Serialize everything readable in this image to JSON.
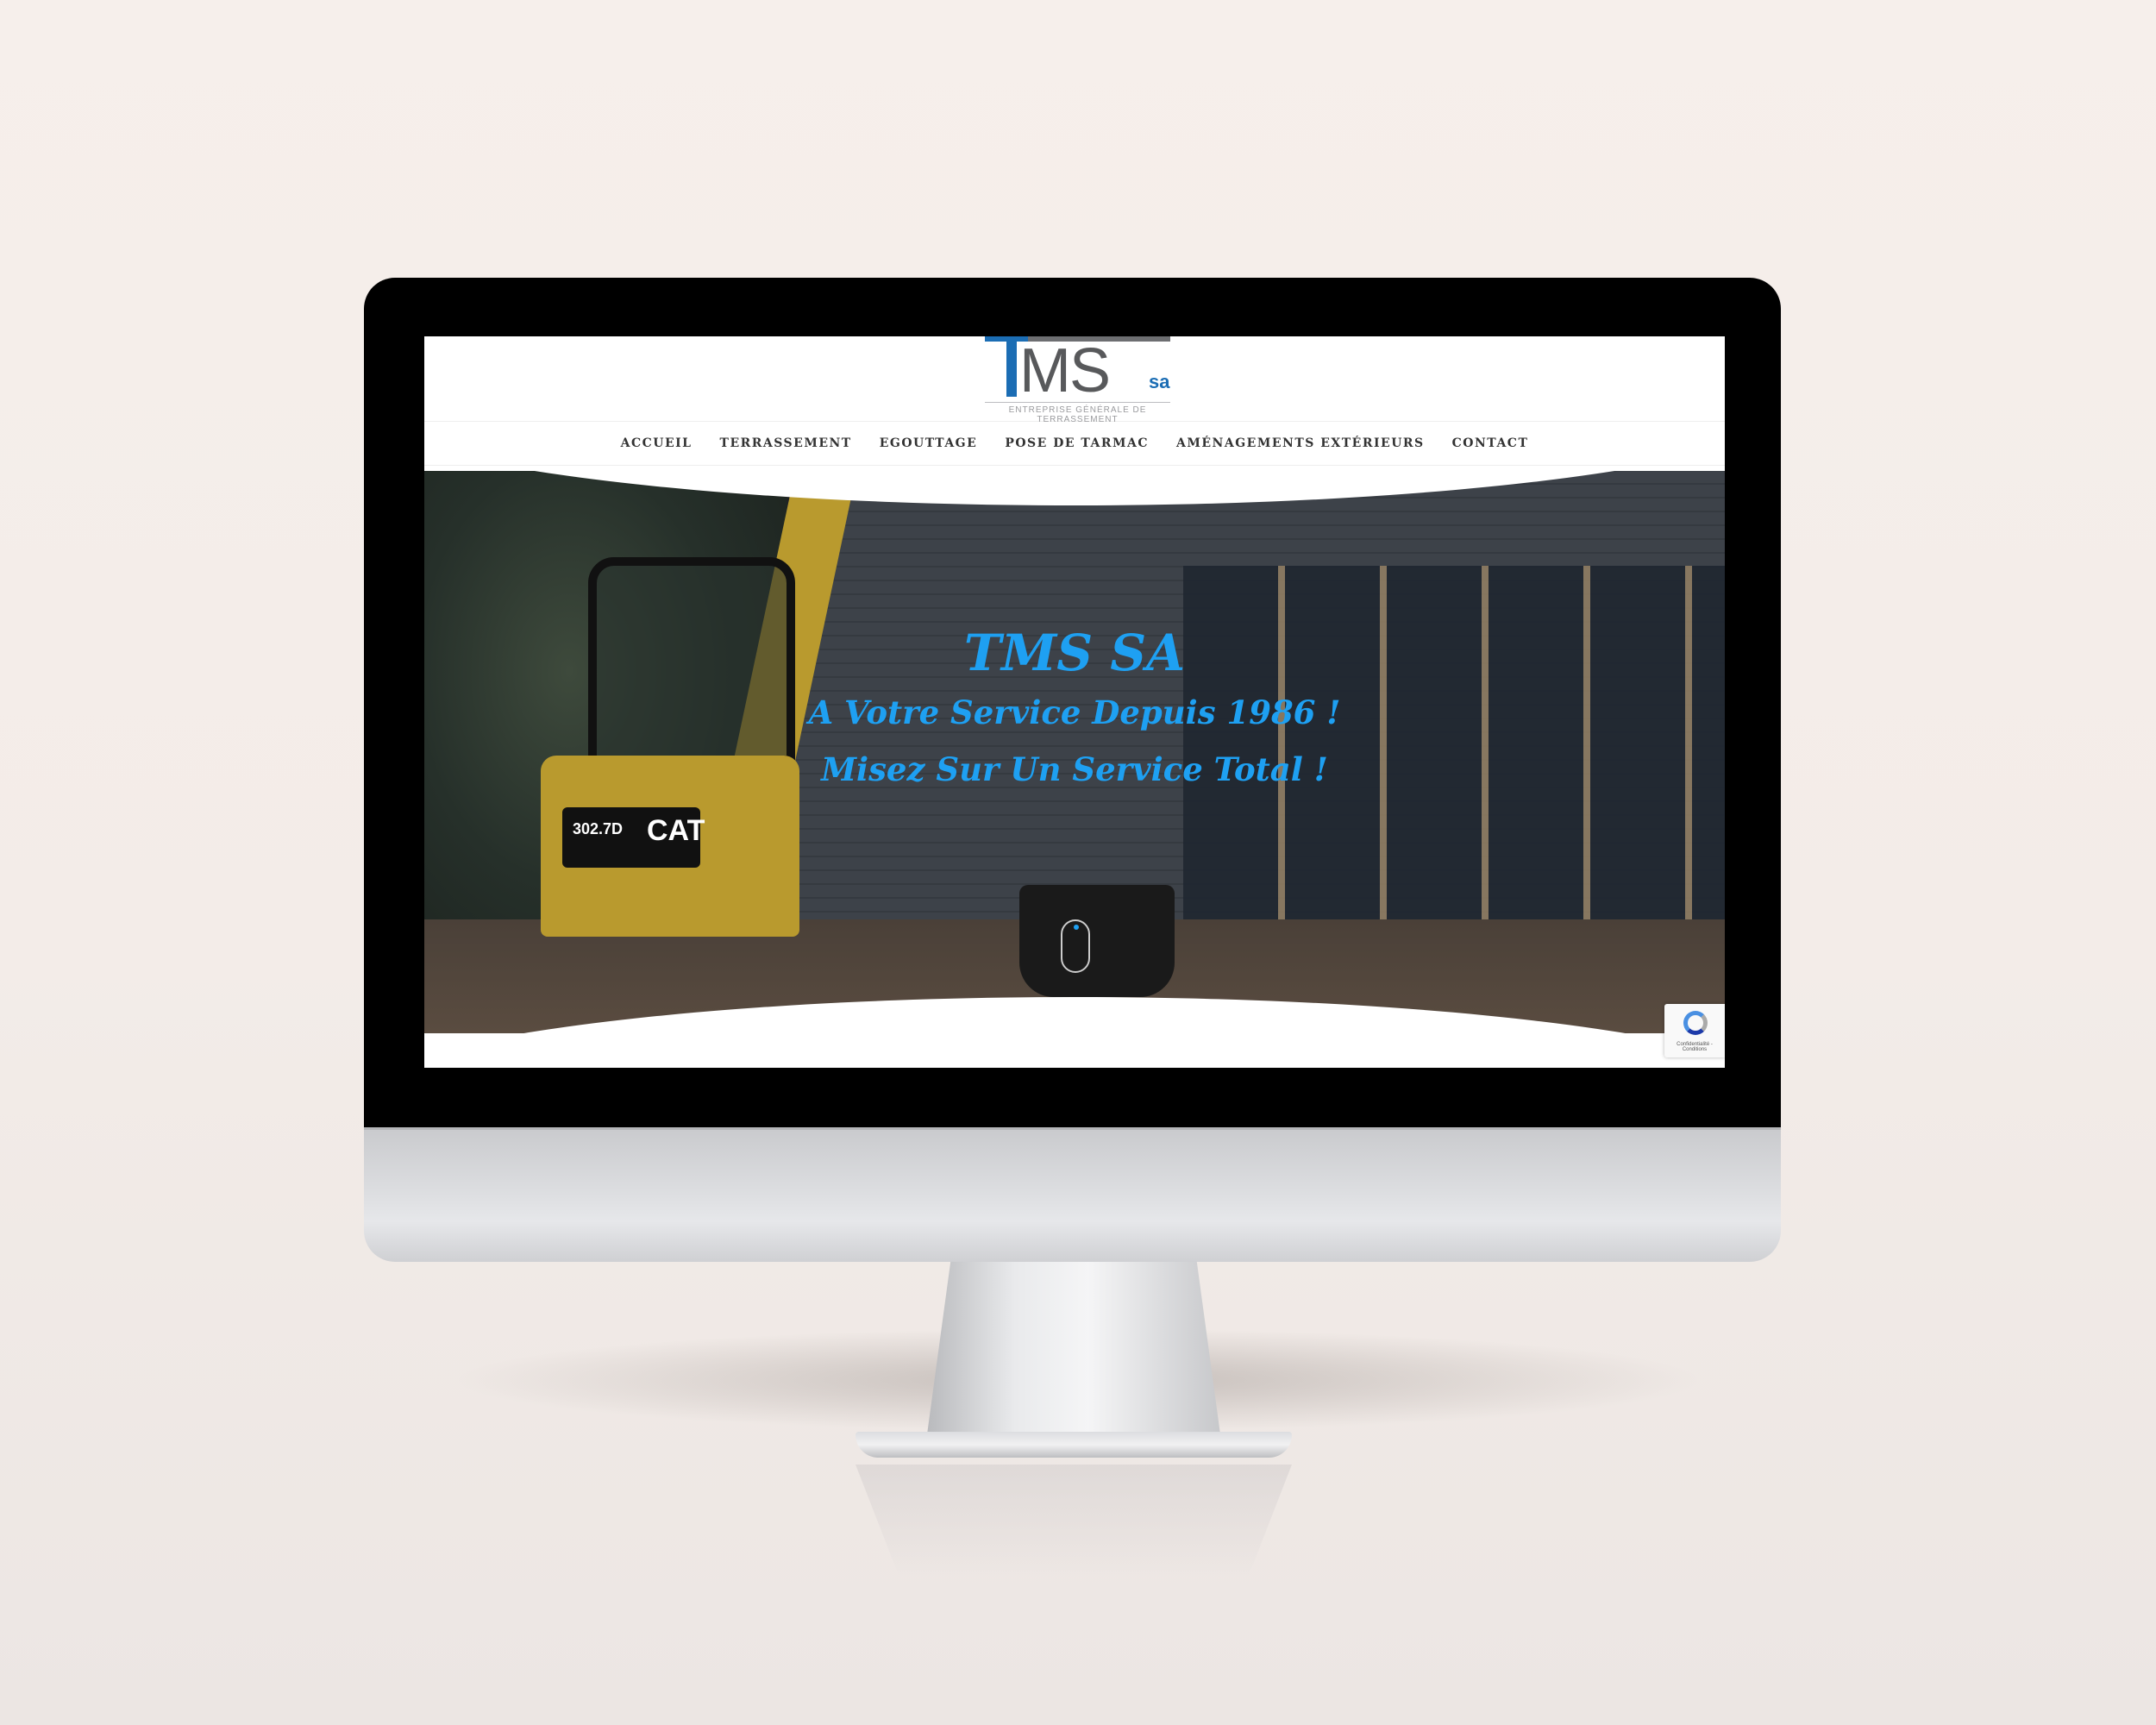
{
  "logo": {
    "main": "MS",
    "suffix": "sa",
    "tagline": "ENTREPRISE GÉNÉRALE DE TERRASSEMENT"
  },
  "nav": {
    "items": [
      {
        "label": "ACCUEIL"
      },
      {
        "label": "TERRASSEMENT"
      },
      {
        "label": "EGOUTTAGE"
      },
      {
        "label": "POSE DE TARMAC"
      },
      {
        "label": "AMÉNAGEMENTS EXTÉRIEURS"
      },
      {
        "label": "CONTACT"
      }
    ]
  },
  "hero": {
    "title": "TMS SA",
    "line1": "A Votre Service Depuis 1986 !",
    "line2": "Misez Sur Un Service Total !",
    "machine_model": "302.7D",
    "machine_brand": "CAT"
  },
  "recaptcha": {
    "text": "Confidentialité - Conditions"
  },
  "colors": {
    "accent": "#1ea0f2",
    "logo_blue": "#1b6db4",
    "logo_grey": "#58595b"
  }
}
